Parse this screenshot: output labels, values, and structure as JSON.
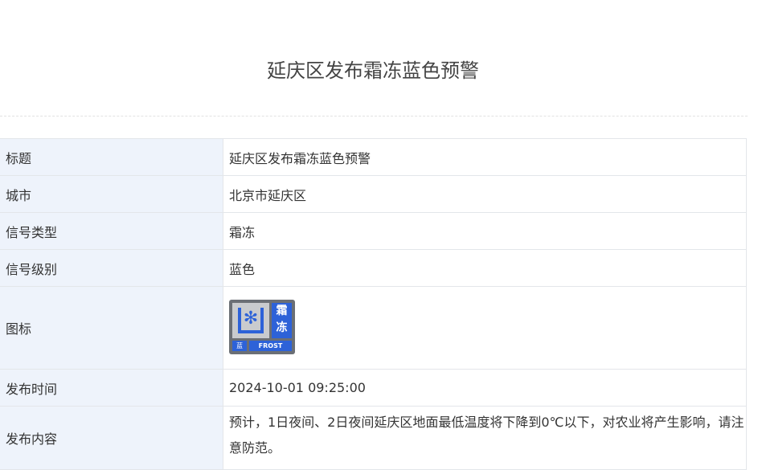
{
  "page_title": "延庆区发布霜冻蓝色预警",
  "rows": [
    {
      "label": "标题",
      "value": "延庆区发布霜冻蓝色预警"
    },
    {
      "label": "城市",
      "value": "北京市延庆区"
    },
    {
      "label": "信号类型",
      "value": "霜冻"
    },
    {
      "label": "信号级别",
      "value": "蓝色"
    },
    {
      "label": "图标"
    },
    {
      "label": "发布时间",
      "value": "2024-10-01 09:25:00"
    },
    {
      "label": "发布内容",
      "value": "预计，1日夜间、2日夜间延庆区地面最低温度将下降到0℃以下，对农业将产生影响，请注意防范。"
    }
  ],
  "signal_icon": {
    "name": "frost-blue-warning-icon",
    "text_cn": "霜冻",
    "level_cn": "蓝",
    "text_en": "FROST",
    "color": "#2d62d8"
  }
}
